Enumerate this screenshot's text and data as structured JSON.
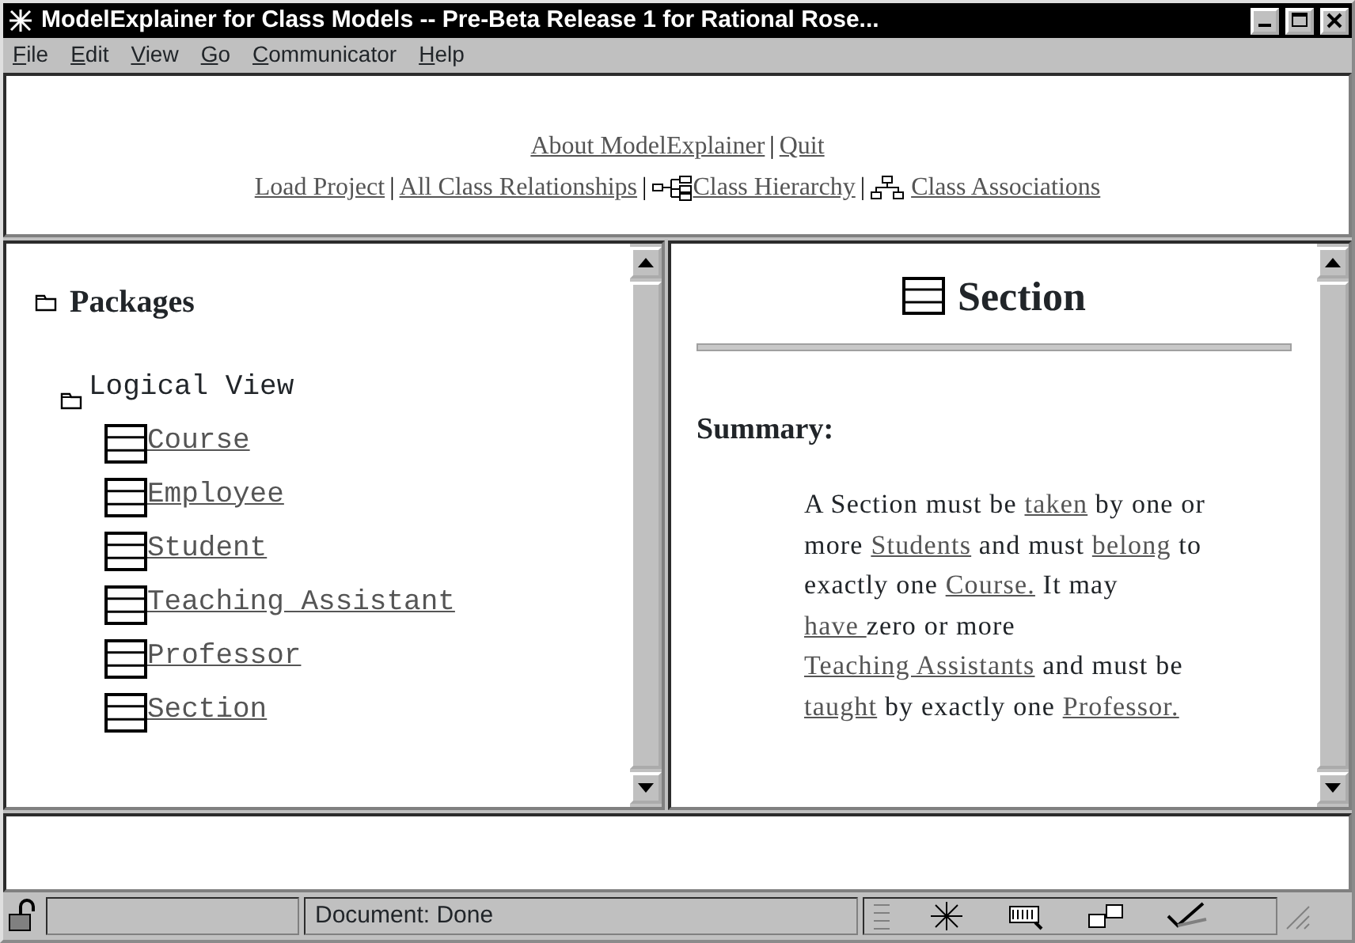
{
  "window": {
    "title": "ModelExplainer for Class Models -- Pre-Beta Release 1 for Rational Rose..."
  },
  "menu": [
    "File",
    "Edit",
    "View",
    "Go",
    "Communicator",
    "Help"
  ],
  "nav_lines": [
    [
      {
        "kind": "link",
        "text": "About ModelExplainer"
      },
      {
        "kind": "separator",
        "text": "|"
      },
      {
        "kind": "link",
        "text": "Quit"
      }
    ],
    [
      {
        "kind": "link",
        "text": "Load Project"
      },
      {
        "kind": "separator",
        "text": "|"
      },
      {
        "kind": "link",
        "text": "All Class Relationships"
      },
      {
        "kind": "separator",
        "text": "|"
      },
      {
        "kind": "hierarchy_link",
        "text": "Class Hierarchy"
      },
      {
        "kind": "separator",
        "text": "|"
      },
      {
        "kind": "association_link",
        "text": "Class Associations"
      }
    ]
  ],
  "packages": {
    "title": "Packages",
    "tree": [
      {
        "label": "Logical View",
        "kind": "package",
        "children": [
          {
            "label": "Course",
            "kind": "class"
          },
          {
            "label": "Employee",
            "kind": "class"
          },
          {
            "label": "Student",
            "kind": "class"
          },
          {
            "label": "Teaching Assistant",
            "kind": "class"
          },
          {
            "label": "Professor",
            "kind": "class"
          },
          {
            "label": "Section",
            "kind": "class"
          }
        ]
      }
    ]
  },
  "detail": {
    "title": "Section",
    "summary_label": "Summary:",
    "summary": [
      {
        "text": "A Section must be ",
        "link": false
      },
      {
        "text": "taken",
        "link": true
      },
      {
        "text": " by one or more ",
        "link": false
      },
      {
        "text": "Students",
        "link": true
      },
      {
        "text": " and must ",
        "link": false
      },
      {
        "text": "belong",
        "link": true
      },
      {
        "text": " to exactly one ",
        "link": false
      },
      {
        "text": "Course.",
        "link": true
      },
      {
        "text": " It may ",
        "link": false
      },
      {
        "text": "have ",
        "link": true
      },
      {
        "text": "zero or more ",
        "link": false
      },
      {
        "text": "Teaching Assistants",
        "link": true
      },
      {
        "text": " and must be ",
        "link": false
      },
      {
        "text": "taught",
        "link": true
      },
      {
        "text": " by exactly one ",
        "link": false
      },
      {
        "text": "Professor.",
        "link": true
      }
    ]
  },
  "status_bar": {
    "text": "Document: Done"
  }
}
